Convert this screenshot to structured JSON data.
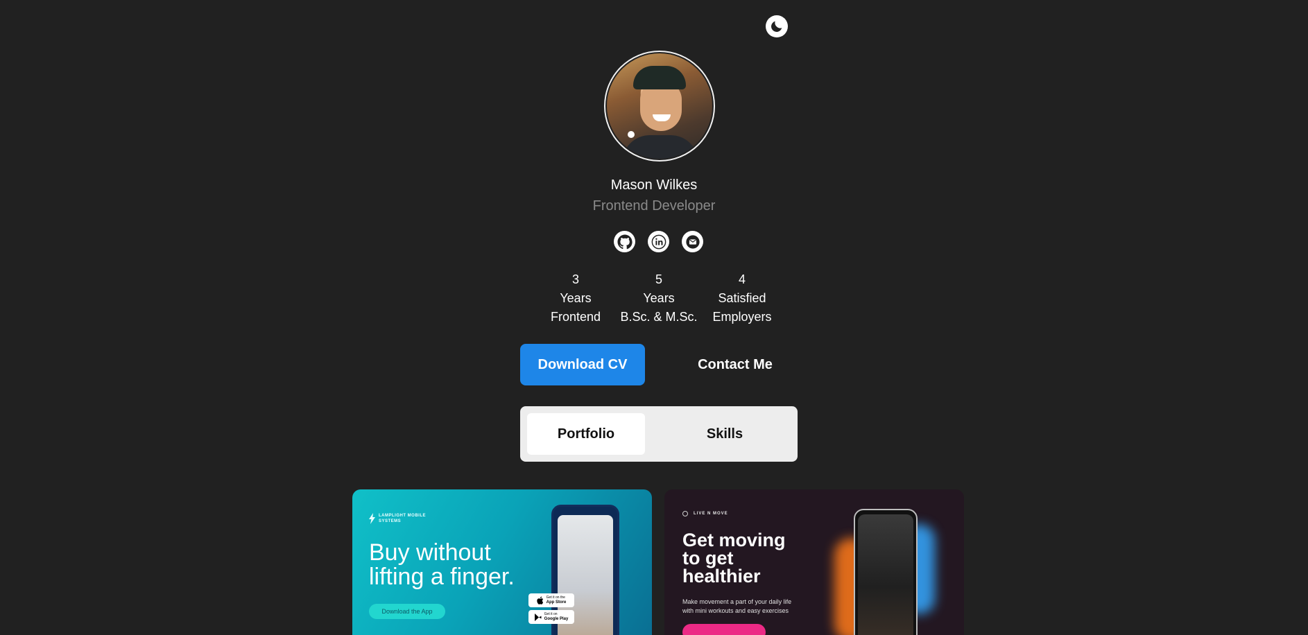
{
  "profile": {
    "name": "Mason Wilkes",
    "role": "Frontend Developer"
  },
  "socials": [
    {
      "icon": "github-icon"
    },
    {
      "icon": "linkedin-icon"
    },
    {
      "icon": "mail-icon"
    }
  ],
  "stats": [
    {
      "value": "3",
      "line1": "Years",
      "line2": "Frontend"
    },
    {
      "value": "5",
      "line1": "Years",
      "line2": "B.Sc. & M.Sc."
    },
    {
      "value": "4",
      "line1": "Satisfied",
      "line2": "Employers"
    }
  ],
  "actions": {
    "download_cv": "Download CV",
    "contact_me": "Contact Me"
  },
  "tabs": {
    "portfolio": "Portfolio",
    "skills": "Skills",
    "active": "Portfolio"
  },
  "portfolio": [
    {
      "brand": "LAMPLIGHT MOBILE SYSTEMS",
      "headline_line1": "Buy without",
      "headline_line2": "lifting a finger.",
      "cta": "Download the App",
      "app_store": "App Store",
      "app_store_pre": "Get it on the",
      "google_play": "Google Play",
      "google_play_pre": "Get it on"
    },
    {
      "brand": "LIVE N MOVE",
      "headline_line1": "Get moving",
      "headline_line2": "to get",
      "headline_line3": "healthier",
      "subtext_line1": "Make movement a part of your daily life",
      "subtext_line2": "with mini workouts and easy exercises"
    }
  ],
  "colors": {
    "background": "#212121",
    "primary": "#1e86e8",
    "muted_text": "#8a8a8a",
    "tab_bg": "#ededed",
    "card1_accent": "#10c0c8",
    "card2_bg": "#231721",
    "card2_accent": "#ec2a86"
  }
}
